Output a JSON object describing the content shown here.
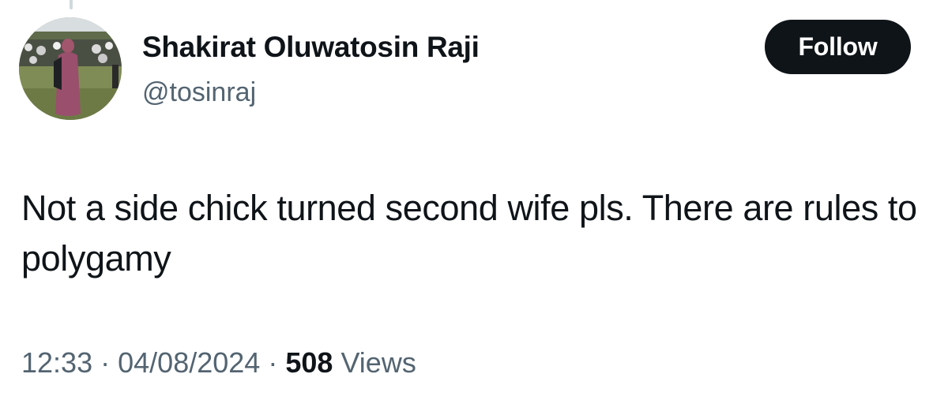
{
  "author": {
    "display_name": "Shakirat Oluwatosin Raji",
    "handle": "@tosinraj"
  },
  "actions": {
    "follow_label": "Follow"
  },
  "tweet": {
    "text": "Not a side chick turned second wife pls. There are rules to polygamy"
  },
  "meta": {
    "time": "12:33",
    "separator": "·",
    "date": "04/08/2024",
    "views_count": "508",
    "views_label": "Views"
  },
  "colors": {
    "text_primary": "#0f1419",
    "text_secondary": "#536471",
    "button_bg": "#0f1419",
    "button_text": "#ffffff",
    "thread_line": "#cfd9de"
  }
}
